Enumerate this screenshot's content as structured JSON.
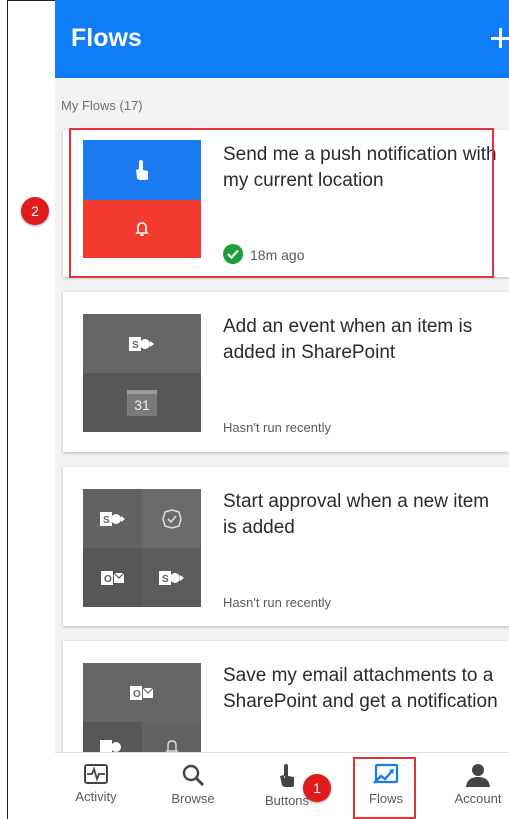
{
  "header": {
    "title": "Flows"
  },
  "section": {
    "label": "My Flows (17)"
  },
  "flows": [
    {
      "title": "Send me a push notification with my current location",
      "status": "18m ago",
      "icons": [
        "touch-icon",
        "bell-icon"
      ]
    },
    {
      "title": "Add an event when an item is added in SharePoint",
      "status": "Hasn't run recently",
      "icons": [
        "sharepoint-icon",
        "calendar-icon"
      ],
      "calendar_day": "31"
    },
    {
      "title": "Start approval when a new item is added",
      "status": "Hasn't run recently",
      "icons": [
        "sharepoint-icon",
        "approval-icon",
        "outlook-icon",
        "sharepoint-icon"
      ]
    },
    {
      "title": "Save my email attachments to a SharePoint and get a notification",
      "status": "",
      "icons": [
        "outlook-icon",
        "sharepoint-icon",
        "notification-icon"
      ]
    }
  ],
  "nav": {
    "items": [
      {
        "label": "Activity",
        "icon": "activity-icon"
      },
      {
        "label": "Browse",
        "icon": "search-icon"
      },
      {
        "label": "Buttons",
        "icon": "touch-icon"
      },
      {
        "label": "Flows",
        "icon": "flows-icon",
        "selected": true
      },
      {
        "label": "Account",
        "icon": "account-icon"
      }
    ]
  },
  "annotations": {
    "badge_1": "1",
    "badge_2": "2"
  },
  "colors": {
    "header": "#0f7df7",
    "accent_red": "#f23a2e",
    "dark_tile": "#5f5f5f",
    "highlight": "#e4323a"
  }
}
